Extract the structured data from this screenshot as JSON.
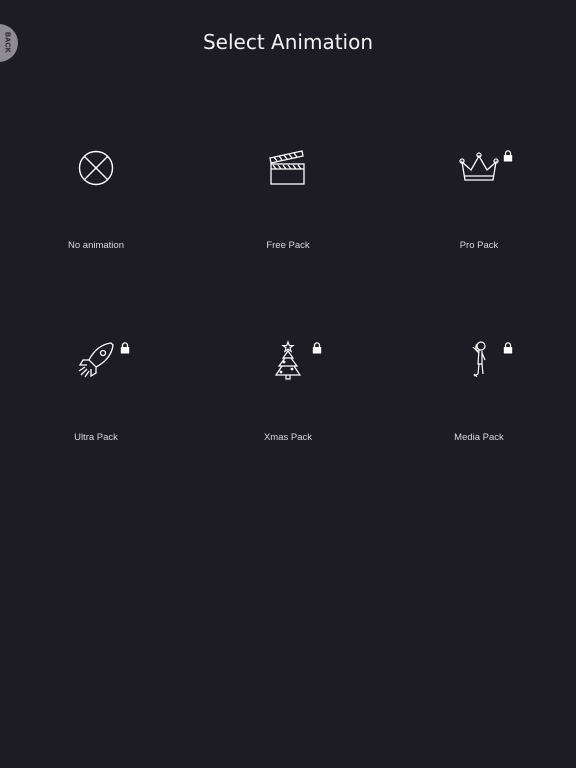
{
  "header": {
    "title": "Select Animation",
    "back_label": "BACK"
  },
  "packs": [
    {
      "label": "No animation",
      "icon": "no-animation-circle-x-icon",
      "locked": false
    },
    {
      "label": "Free Pack",
      "icon": "clapperboard-icon",
      "locked": false
    },
    {
      "label": "Pro Pack",
      "icon": "crown-icon",
      "locked": true
    },
    {
      "label": "Ultra Pack",
      "icon": "rocket-icon",
      "locked": true
    },
    {
      "label": "Xmas Pack",
      "icon": "christmas-tree-icon",
      "locked": true
    },
    {
      "label": "Media Pack",
      "icon": "stick-figure-icon",
      "locked": true
    }
  ],
  "colors": {
    "background": "#1d1b24",
    "back_button": "#8e8c92",
    "text": "#ffffff"
  }
}
